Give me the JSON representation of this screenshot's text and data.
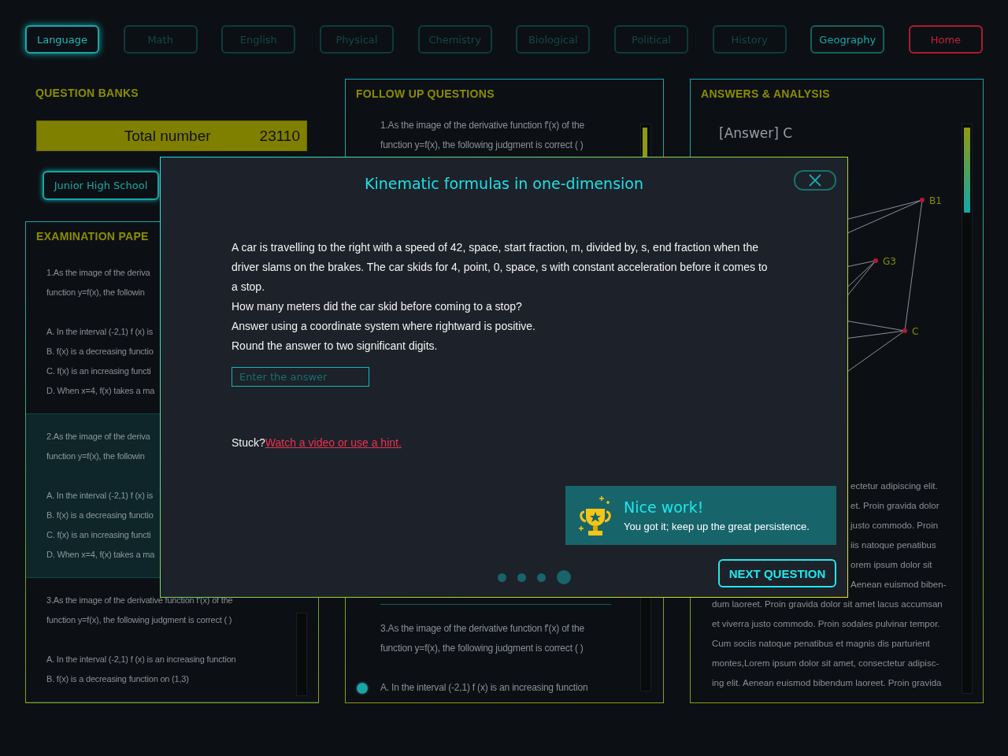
{
  "nav": [
    {
      "label": "Language",
      "kind": "tab",
      "selected": true,
      "disabled": false
    },
    {
      "label": "Math",
      "kind": "tab",
      "selected": false,
      "disabled": true
    },
    {
      "label": "English",
      "kind": "tab",
      "selected": false,
      "disabled": true
    },
    {
      "label": "Physical",
      "kind": "tab",
      "selected": false,
      "disabled": true
    },
    {
      "label": "Chemistry",
      "kind": "tab",
      "selected": false,
      "disabled": true
    },
    {
      "label": "Biological",
      "kind": "tab",
      "selected": false,
      "disabled": true
    },
    {
      "label": "Political",
      "kind": "tab",
      "selected": false,
      "disabled": true
    },
    {
      "label": "History",
      "kind": "tab",
      "selected": false,
      "disabled": true
    },
    {
      "label": "Geography",
      "kind": "tab",
      "selected": false,
      "disabled": false
    },
    {
      "label": "Home",
      "kind": "home",
      "selected": false,
      "disabled": false
    }
  ],
  "question_banks": {
    "title": "QUESTION BANKS",
    "total_label": "Total number",
    "total_value": "23110",
    "level_button": "Junior High School"
  },
  "examination_papers": {
    "title": "EXAMINATION PAPE",
    "questions": [
      {
        "selected": false,
        "lines": [
          "1.As the image of the deriva",
          "function y=f(x), the followin"
        ],
        "options": [
          "A. In the interval (-2,1) f (x) is",
          "B. f(x) is a decreasing functio",
          "C. f(x) is an increasing functi",
          "D. When x=4, f(x) takes a ma"
        ]
      },
      {
        "selected": true,
        "lines": [
          "2.As the image of the deriva",
          "function y=f(x), the followin"
        ],
        "options": [
          "A. In the interval (-2,1) f (x) is",
          "B. f(x) is a decreasing functio",
          "C. f(x) is an increasing functi",
          "D. When x=4, f(x) takes a ma"
        ]
      },
      {
        "selected": false,
        "lines": [
          "3.As the image of the derivative function f'(x) of the",
          "function y=f(x), the following judgment is correct (      )"
        ],
        "options": [
          "A. In the interval (-2,1) f (x) is an increasing function",
          "B. f(x) is a decreasing function on (1,3)"
        ]
      }
    ]
  },
  "follow_up": {
    "title": "FOLLOW UP QUESTIONS",
    "top_lines": [
      "1.As the image of the derivative function f'(x) of the",
      "function y=f(x), the following judgment is correct (      )"
    ],
    "bottom_lines": [
      "3.As the image of the derivative function f'(x) of the",
      "function y=f(x), the following judgment is correct (      )"
    ],
    "options": [
      {
        "text": "A. In the interval (-2,1) f (x) is an increasing function",
        "selected": true
      }
    ]
  },
  "answers": {
    "title": "ANSWERS & ANALYSIS",
    "answer": "[Answer] C",
    "graph": {
      "nodes": [
        {
          "label": "B1"
        },
        {
          "label": "G3"
        },
        {
          "label": "C"
        }
      ]
    },
    "partial_lines": [
      "ectetur adipiscing elit.",
      "et. Proin gravida dolor",
      "justo commodo. Proin",
      "iis natoque penatibus",
      "orem ipsum dolor sit",
      "Aenean euismod biben-"
    ],
    "lines": [
      "dum laoreet. Proin gravida dolor sit amet lacus accumsan",
      "et viverra justo commodo. Proin sodales pulvinar tempor.",
      "Cum sociis natoque penatibus et magnis dis parturient",
      "montes,Lorem ipsum dolor sit amet, consectetur adipisc-",
      "ing elit. Aenean euismod bibendum laoreet. Proin gravida"
    ]
  },
  "modal": {
    "title": "Kinematic formulas in one-dimension",
    "problem": [
      "A car is travelling to the right with a speed of 42, space, start fraction, m, divided by, s, end fraction when the driver slams on the brakes. The car skids for 4, point, 0, space, s with constant acceleration before it comes to a stop.",
      "How many meters did the car skid before coming to a stop?",
      "Answer using a coordinate system where rightward is positive.",
      "Round the answer to two significant digits."
    ],
    "answer_field": {
      "placeholder": "Enter the answer"
    },
    "stuck_text": "Stuck?",
    "hint_link": "Watch a video or use a hint.",
    "toast": {
      "title": "Nice work!",
      "message": "You got it; keep up the great persistence."
    },
    "steps": [
      {
        "selected": false
      },
      {
        "selected": false
      },
      {
        "selected": false
      },
      {
        "selected": true
      }
    ],
    "next_button": "NEXT QUESTION"
  }
}
